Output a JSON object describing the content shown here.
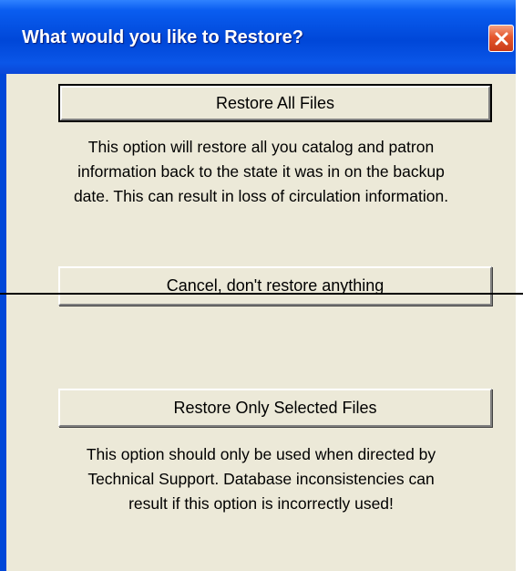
{
  "dialog": {
    "title": "What would you like to Restore?",
    "close_icon": "close-icon"
  },
  "options": [
    {
      "button_label": "Restore All Files",
      "description": [
        "This option will restore all you catalog and patron",
        "information back to the state it was in on the backup",
        "date.  This can result in loss of circulation information."
      ]
    },
    {
      "button_label": "Cancel, don't restore anything"
    },
    {
      "button_label": "Restore Only Selected Files",
      "description": [
        "This option should only be used when directed by",
        "Technical Support.  Database inconsistencies can",
        "result if this option is incorrectly used!"
      ]
    }
  ],
  "colors": {
    "title_bar": "#0047d8",
    "close_button": "#e5572d",
    "dialog_face": "#ece9d8"
  }
}
